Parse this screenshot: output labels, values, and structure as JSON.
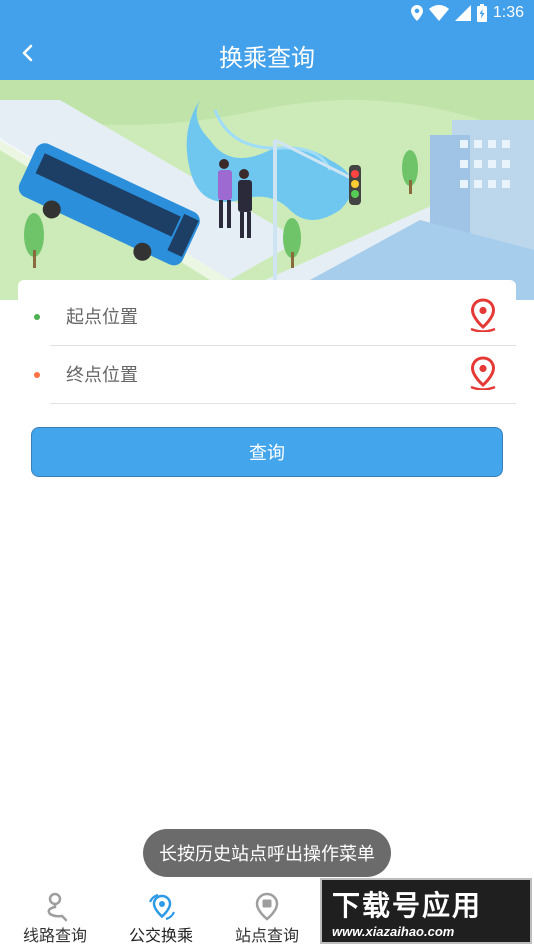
{
  "status_bar": {
    "time": "1:36"
  },
  "app_bar": {
    "title": "换乘查询",
    "back_icon": "back-chevron-icon"
  },
  "form": {
    "start_placeholder": "起点位置",
    "end_placeholder": "终点位置",
    "start_dot_color": "#4caf50",
    "end_dot_color": "#ff7043",
    "pin_color": "#e53935"
  },
  "query_button": {
    "label": "查询"
  },
  "toast": {
    "text": "长按历史站点呼出操作菜单"
  },
  "bottom_nav": {
    "items": [
      {
        "label": "线路查询",
        "icon": "route-icon",
        "active": false
      },
      {
        "label": "公交换乘",
        "icon": "transfer-icon",
        "active": true
      },
      {
        "label": "站点查询",
        "icon": "station-icon",
        "active": false
      }
    ]
  },
  "watermark": {
    "title": "下载号应用",
    "url": "www.xiazaihao.com"
  },
  "colors": {
    "primary": "#43a0ea",
    "toast_bg": "#6b6b6b"
  }
}
